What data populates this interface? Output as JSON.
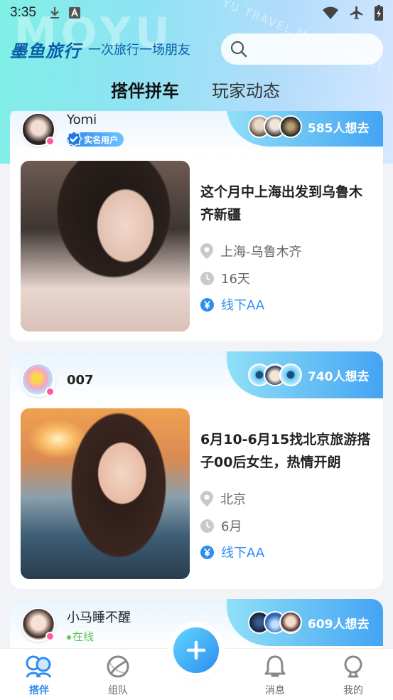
{
  "status": {
    "time": "3:35"
  },
  "brand": {
    "name": "墨鱼旅行",
    "slogan": "一次旅行一场朋友",
    "watermark": "MOYU",
    "watermark_small": "YU TRAVEL MOYU TRAVEL"
  },
  "tabs": [
    {
      "label": "搭伴拼车",
      "active": true
    },
    {
      "label": "玩家动态",
      "active": false
    }
  ],
  "posts": [
    {
      "username": "Yomi",
      "badge": "实名用户",
      "want_count": "585人想去",
      "title": "这个月中上海出发到乌鲁木齐新疆",
      "route": "上海-乌鲁木齐",
      "duration": "16天",
      "payment": "线下AA"
    },
    {
      "username": "007",
      "want_count": "740人想去",
      "title": "6月10-6月15找北京旅游搭子00后女生，热情开朗",
      "route": "北京",
      "duration": "6月",
      "payment": "线下AA"
    },
    {
      "username": "小马睡不醒",
      "status": "在线",
      "want_count": "609人想去"
    }
  ],
  "nav": [
    {
      "label": "搭伴",
      "icon": "partner-icon",
      "active": true
    },
    {
      "label": "组队",
      "icon": "team-icon",
      "active": false
    },
    {
      "label": "",
      "icon": "plus-icon",
      "active": false
    },
    {
      "label": "消息",
      "icon": "bell-icon",
      "active": false
    },
    {
      "label": "我的",
      "icon": "profile-icon",
      "active": false
    }
  ],
  "colors": {
    "accent": "#2c8cf0",
    "brand": "#0b5fa8",
    "online": "#5bc65b",
    "female": "#ff5aa0"
  }
}
